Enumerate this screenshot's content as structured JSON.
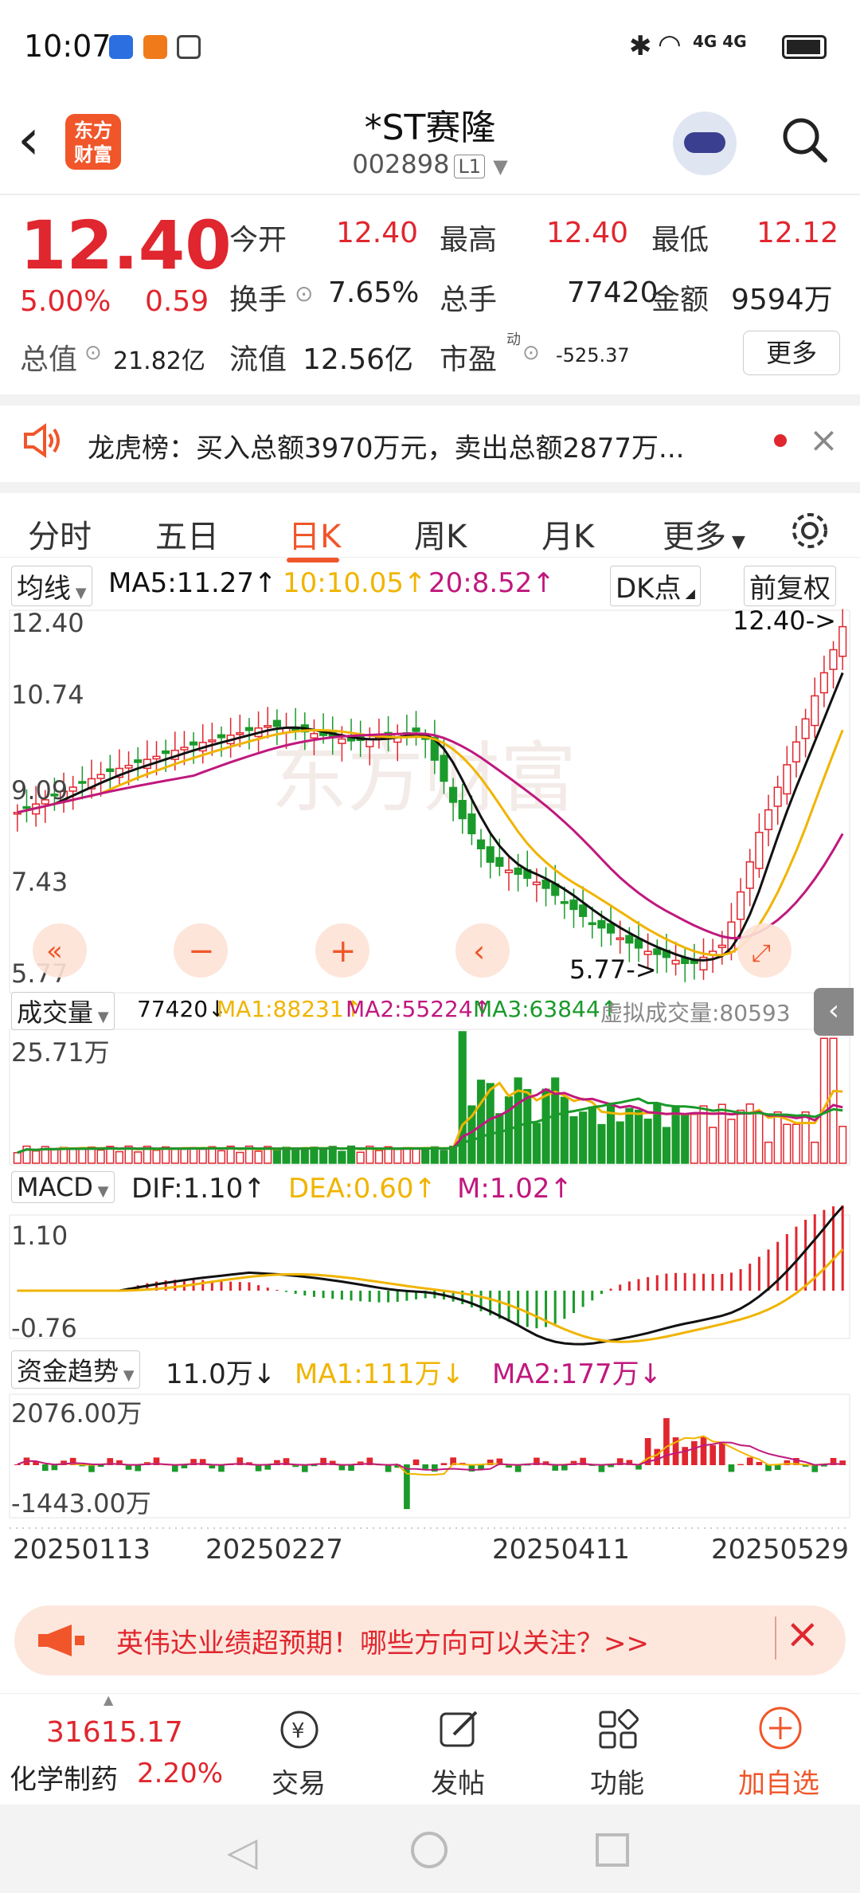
{
  "status_bar": {
    "time": "10:07",
    "network": "4G 4G"
  },
  "header": {
    "logo_text": "东方财富",
    "name": "*ST赛隆",
    "code": "002898",
    "market_tag": "L1"
  },
  "quote": {
    "price": "12.40",
    "change_pct": "5.00%",
    "change": "0.59",
    "open_label": "今开",
    "open": "12.40",
    "high_label": "最高",
    "high": "12.40",
    "low_label": "最低",
    "low": "12.12",
    "turnover_label": "换手",
    "turnover": "7.65%",
    "volume_label": "总手",
    "volume": "77420",
    "amount_label": "金额",
    "amount": "9594万",
    "mktcap_label": "总值",
    "mktcap": "21.82亿",
    "float_label": "流值",
    "float_cap": "12.56亿",
    "pe_label": "市盈",
    "pe_sup": "动",
    "pe": "-525.37",
    "more": "更多"
  },
  "news": {
    "text": "龙虎榜：买入总额3970万元，卖出总额2877万..."
  },
  "tabs": {
    "t1": "分时",
    "t2": "五日",
    "t3": "日K",
    "t4": "周K",
    "t5": "月K",
    "t6": "更多"
  },
  "kline": {
    "ma_select": "均线",
    "ma5": "MA5:11.27↑",
    "ma10": "10:10.05↑",
    "ma20": "20:8.52↑",
    "dk": "DK点",
    "fq": "前复权",
    "y_labels": [
      "12.40",
      "10.74",
      "9.09",
      "7.43",
      "5.77"
    ],
    "max_label": "12.40->",
    "min_label": "5.77->"
  },
  "volume": {
    "select": "成交量",
    "vol": "77420↓",
    "ma1": "MA1:88231↑",
    "ma2": "MA2:55224↑",
    "ma3": "MA3:63844↑",
    "virtual": "虚拟成交量:80593",
    "y_max": "25.71万"
  },
  "macd": {
    "select": "MACD",
    "dif": "DIF:1.10↑",
    "dea": "DEA:0.60↑",
    "m": "M:1.02↑",
    "y_top": "1.10",
    "y_bottom": "-0.76"
  },
  "fund": {
    "select": "资金趋势",
    "val": "11.0万↓",
    "ma1": "MA1:111万↓",
    "ma2": "MA2:177万↓",
    "y_top": "2076.00万",
    "y_bottom": "-1443.00万"
  },
  "x_dates": [
    "20250113",
    "20250227",
    "20250411",
    "20250529"
  ],
  "banner": {
    "text": "英伟达业绩超预期！哪些方向可以关注？>>"
  },
  "bottom_nav": {
    "index_value": "31615.17",
    "index_name": "化学制药",
    "index_pct": "2.20%",
    "trade": "交易",
    "post": "发帖",
    "func": "功能",
    "add": "加自选"
  },
  "colors": {
    "up": "#e0262e",
    "down": "#1a9a2a",
    "accent": "#f0562a",
    "ma10": "#f0b400",
    "ma20": "#c0187e"
  }
}
